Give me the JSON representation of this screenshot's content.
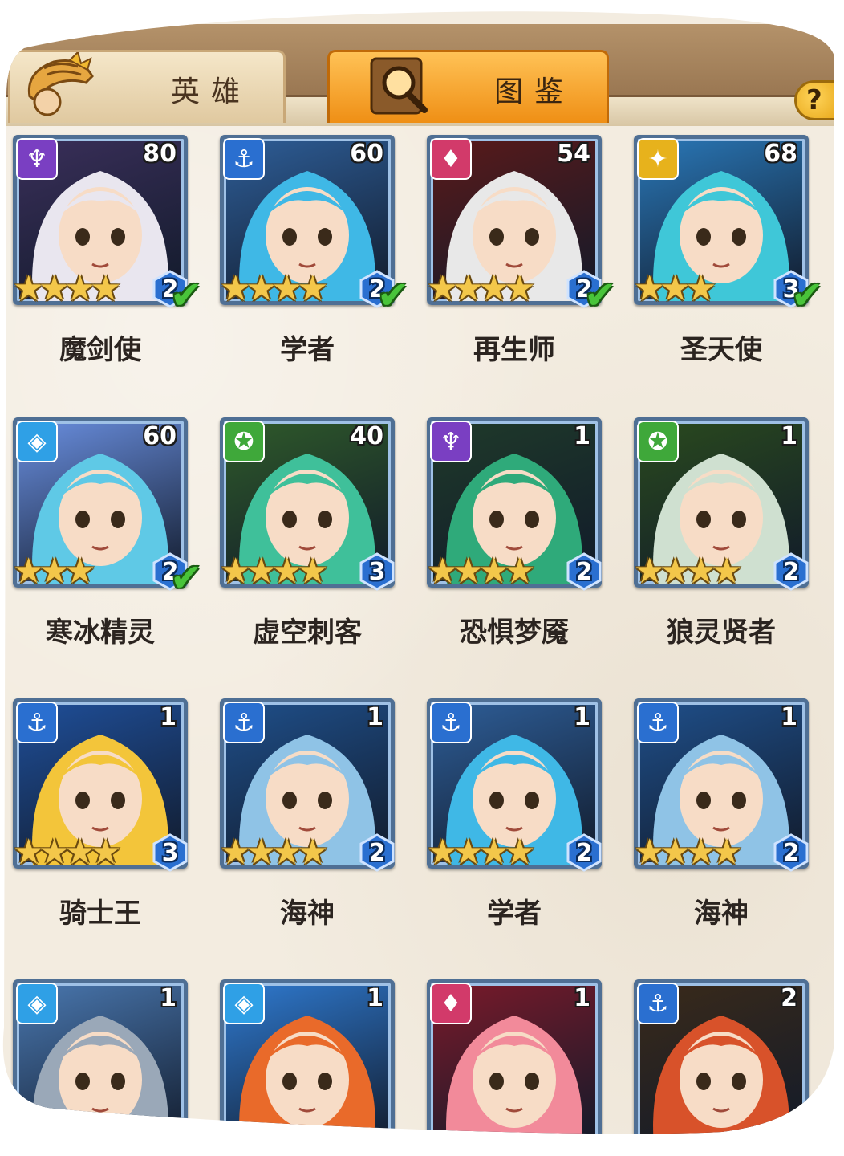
{
  "tabs": [
    {
      "label": "英雄",
      "icon": "knight-helmet-icon",
      "active": false
    },
    {
      "label": "图鉴",
      "icon": "magnifier-book-icon",
      "active": true
    }
  ],
  "help": {
    "label": "?"
  },
  "colors": {
    "tab_active": "#ef8f15",
    "tab_inactive": "#e0c9a0",
    "background": "#f3ece0",
    "card_border": "#4f6f94",
    "star": "#f3c74a",
    "tier_badge": "#2a6fd0",
    "check": "#49c43a"
  },
  "heroes": [
    {
      "name": "魔剑使",
      "level": "80",
      "faction": "dark-horns-icon",
      "faction_color": "#7a3fc2",
      "stars": 4,
      "tier": "2",
      "checked": true,
      "bg": "#3a2f5a",
      "hair": "#e9e6ef"
    },
    {
      "name": "学者",
      "level": "60",
      "faction": "anchor-icon",
      "faction_color": "#2a6fd0",
      "stars": 4,
      "tier": "2",
      "checked": true,
      "bg": "#2e5e98",
      "hair": "#3fb8e6"
    },
    {
      "name": "再生师",
      "level": "54",
      "faction": "crystal-icon",
      "faction_color": "#d23a6a",
      "stars": 4,
      "tier": "2",
      "checked": true,
      "bg": "#5a1a1a",
      "hair": "#e8e8e8"
    },
    {
      "name": "圣天使",
      "level": "68",
      "faction": "wings-icon",
      "faction_color": "#e7b21c",
      "stars": 3,
      "tier": "3",
      "checked": true,
      "bg": "#2a78b8",
      "hair": "#3fc7d8"
    },
    {
      "name": "寒冰精灵",
      "level": "60",
      "faction": "diamond-icon",
      "faction_color": "#2fa0e6",
      "stars": 3,
      "tier": "2",
      "checked": true,
      "bg": "#6a8fe0",
      "hair": "#5fc9e6"
    },
    {
      "name": "虚空刺客",
      "level": "40",
      "faction": "beast-icon",
      "faction_color": "#3fa83a",
      "stars": 4,
      "tier": "3",
      "checked": false,
      "bg": "#2f5a2a",
      "hair": "#3fc09a"
    },
    {
      "name": "恐惧梦魇",
      "level": "1",
      "faction": "dark-horns-icon",
      "faction_color": "#7a3fc2",
      "stars": 4,
      "tier": "2",
      "checked": false,
      "bg": "#1f3a2a",
      "hair": "#2faa7a"
    },
    {
      "name": "狼灵贤者",
      "level": "1",
      "faction": "beast-icon",
      "faction_color": "#3fa83a",
      "stars": 4,
      "tier": "2",
      "checked": false,
      "bg": "#2a4a1e",
      "hair": "#cfe0d0"
    },
    {
      "name": "骑士王",
      "level": "1",
      "faction": "anchor-icon",
      "faction_color": "#2a6fd0",
      "stars": 4,
      "tier": "3",
      "checked": false,
      "bg": "#1f4f9a",
      "hair": "#f3c53a"
    },
    {
      "name": "海神",
      "level": "1",
      "faction": "anchor-icon",
      "faction_color": "#2a6fd0",
      "stars": 4,
      "tier": "2",
      "checked": false,
      "bg": "#1f4f8a",
      "hair": "#8fc3e6"
    },
    {
      "name": "学者",
      "level": "1",
      "faction": "anchor-icon",
      "faction_color": "#2a6fd0",
      "stars": 4,
      "tier": "2",
      "checked": false,
      "bg": "#2e5e98",
      "hair": "#3fb8e6"
    },
    {
      "name": "海神",
      "level": "1",
      "faction": "anchor-icon",
      "faction_color": "#2a6fd0",
      "stars": 4,
      "tier": "2",
      "checked": false,
      "bg": "#1f4f8a",
      "hair": "#8fc3e6"
    },
    {
      "name": "",
      "level": "1",
      "faction": "diamond-icon",
      "faction_color": "#2fa0e6",
      "stars": 0,
      "tier": "",
      "checked": false,
      "bg": "#4a78b0",
      "hair": "#9aa8b8"
    },
    {
      "name": "",
      "level": "1",
      "faction": "diamond-icon",
      "faction_color": "#2fa0e6",
      "stars": 0,
      "tier": "",
      "checked": false,
      "bg": "#2f7ad0",
      "hair": "#e96a2a"
    },
    {
      "name": "",
      "level": "1",
      "faction": "crystal-icon",
      "faction_color": "#d23a6a",
      "stars": 0,
      "tier": "",
      "checked": false,
      "bg": "#7a1a2a",
      "hair": "#f28a9a"
    },
    {
      "name": "",
      "level": "2",
      "faction": "anchor-icon",
      "faction_color": "#2a6fd0",
      "stars": 0,
      "tier": "",
      "checked": false,
      "bg": "#3a2a1a",
      "hair": "#d8522a"
    }
  ]
}
